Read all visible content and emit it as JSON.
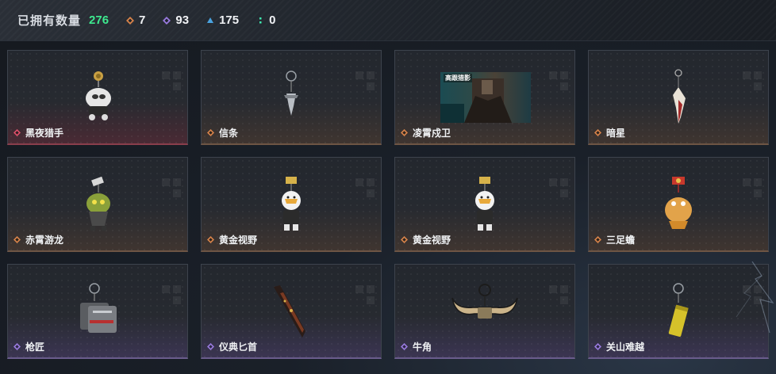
{
  "summary": {
    "owned_label": "已拥有数量",
    "owned_count": "276",
    "stats": [
      {
        "icon": "orange-gem-icon",
        "color": "#d9844a",
        "value": "7"
      },
      {
        "icon": "purple-gem-icon",
        "color": "#9a7be0",
        "value": "93"
      },
      {
        "icon": "blue-gem-icon",
        "color": "#4aa3e0",
        "value": "175"
      },
      {
        "icon": "green-gem-icon",
        "color": "#3ee9b0",
        "value": "0"
      }
    ]
  },
  "items": [
    {
      "name": "黑夜猎手",
      "rarity": "red",
      "gem_color": "#e0506a",
      "art": "white-creature-charm"
    },
    {
      "name": "信条",
      "rarity": "orange",
      "gem_color": "#d9844a",
      "art": "silver-blade-charm"
    },
    {
      "name": "凌霄戍卫",
      "rarity": "orange",
      "gem_color": "#d9844a",
      "art": "video-preview",
      "video_caption": "高跟猎影"
    },
    {
      "name": "暗星",
      "rarity": "orange",
      "gem_color": "#d9844a",
      "art": "feather-pendant-charm"
    },
    {
      "name": "赤霄游龙",
      "rarity": "orange",
      "gem_color": "#d9844a",
      "art": "green-dragon-charm"
    },
    {
      "name": "黄金视野",
      "rarity": "orange",
      "gem_color": "#d9844a",
      "art": "chick-figure-charm"
    },
    {
      "name": "黄金视野",
      "rarity": "orange",
      "gem_color": "#d9844a",
      "art": "chick-figure-charm"
    },
    {
      "name": "三足蟾",
      "rarity": "orange",
      "gem_color": "#d9844a",
      "art": "golden-toad-charm"
    },
    {
      "name": "枪匠",
      "rarity": "purple",
      "gem_color": "#9a7be0",
      "art": "metal-tag-charm"
    },
    {
      "name": "仪典匕首",
      "rarity": "purple",
      "gem_color": "#9a7be0",
      "art": "dagger-charm"
    },
    {
      "name": "牛角",
      "rarity": "purple",
      "gem_color": "#9a7be0",
      "art": "horn-charm"
    },
    {
      "name": "关山难越",
      "rarity": "purple",
      "gem_color": "#9a7be0",
      "art": "yellow-cylinder-charm"
    }
  ]
}
